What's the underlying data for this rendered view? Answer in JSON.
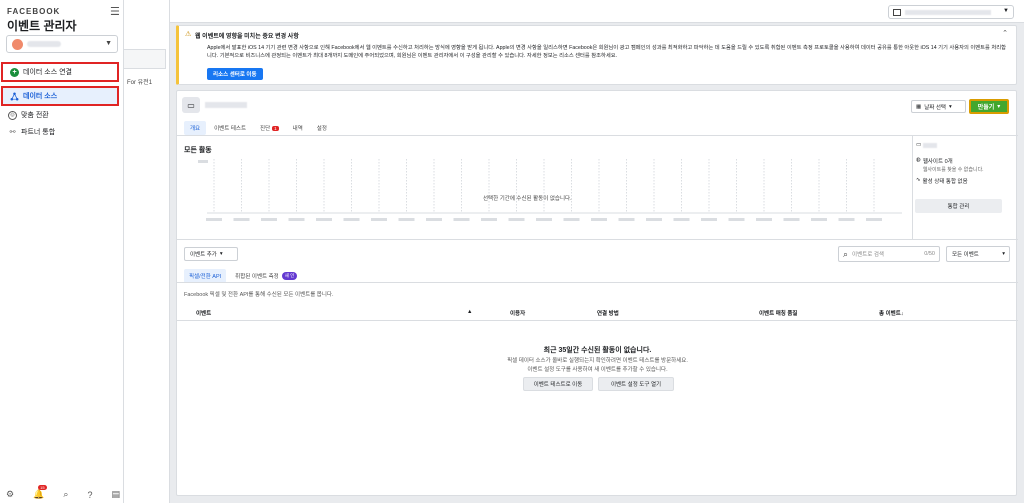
{
  "sidebar": {
    "brand": "FACEBOOK",
    "app_title": "이벤트 관리자",
    "nav": {
      "connect": "데이터 소스 연결",
      "sources": "데이터 소스",
      "custom_conversions": "맞춤 전환",
      "partner_integrations": "파트너 통합"
    },
    "notification_count": "15"
  },
  "subpanel": {
    "item_text": "For 유전1"
  },
  "notice": {
    "title": "웹 이벤트에 영향을 미치는 중요 변경 사항",
    "body": "Apple에서 발표한 iOS 14 기기 관련 변경 사항으로 인해 Facebook에서 웹 이벤트를 수신하고 처리하는 방식에 영향을 받게 됩니다. Apple의 변경 사항을 일리스하면 Facebook은 회원님이 광고 캠페인의 성과를 최적화하고 파악하는 데 도움을 드릴 수 있도록 취합된 이벤트 측정 프로토콜을 사용하여 데이터 공유를 통한 아웃한 iOS 14 기기 사용자의 이벤트를 처리합니다. 기본적으로 비즈니스에 관정되는 이벤트가 최대 8개까지 도메인에 주어되었으며, 회원님은 이벤트 관리자에서 이 구성을 관리할 수 있습니다. 자세한 정보는 리소스 센터를 참조하세요.",
    "button": "리소스 센터로 이동"
  },
  "card": {
    "date_button": "날짜 선택",
    "create_button": "만들기",
    "tabs": [
      {
        "label": "개요",
        "badge": ""
      },
      {
        "label": "이벤트 테스트",
        "badge": ""
      },
      {
        "label": "진단",
        "badge": "1"
      },
      {
        "label": "내역",
        "badge": ""
      },
      {
        "label": "설정",
        "badge": ""
      }
    ],
    "activity_title": "모든 활동",
    "empty_chart": "선택한 기간에 수신된 활동이 없습니다.",
    "side": {
      "website_title": "웹사이트 0개",
      "website_sub": "웹사이트를 찾을 수 없습니다.",
      "integration": "활성 상태 통합 없음",
      "manage_button": "통합 관리"
    },
    "add_event": "이벤트 추가",
    "search_placeholder": "이벤트로 검색",
    "search_count": "0/50",
    "all_events": "모든 이벤트",
    "subtabs": {
      "pixel_api": "픽셀/전환 API",
      "aggregated": "취합된 이벤트 측정",
      "new_badge": "새 인"
    },
    "subtab_desc": "Facebook 픽셀 및 전환 API를 통해 수신된 모든 이벤트를 봅니다.",
    "columns": {
      "event": "이벤트",
      "user": "이용자",
      "connection": "연결 방법",
      "match_quality": "이벤트 매칭 품질",
      "total": "총 이벤트↓"
    },
    "empty": {
      "title": "최근 35일간 수신된 활동이 없습니다.",
      "line1": "픽셀 데이터 소스가 올바로 실행되는지 확인하려면 이벤트 테스트를 방문하세요.",
      "line2": "이벤트 설정 도구를 사용하여 새 이벤트를 추가할 수 있습니다.",
      "test_button": "이벤트 테스트로 이동",
      "setup_button": "이벤트 설정 도구 열기"
    }
  }
}
